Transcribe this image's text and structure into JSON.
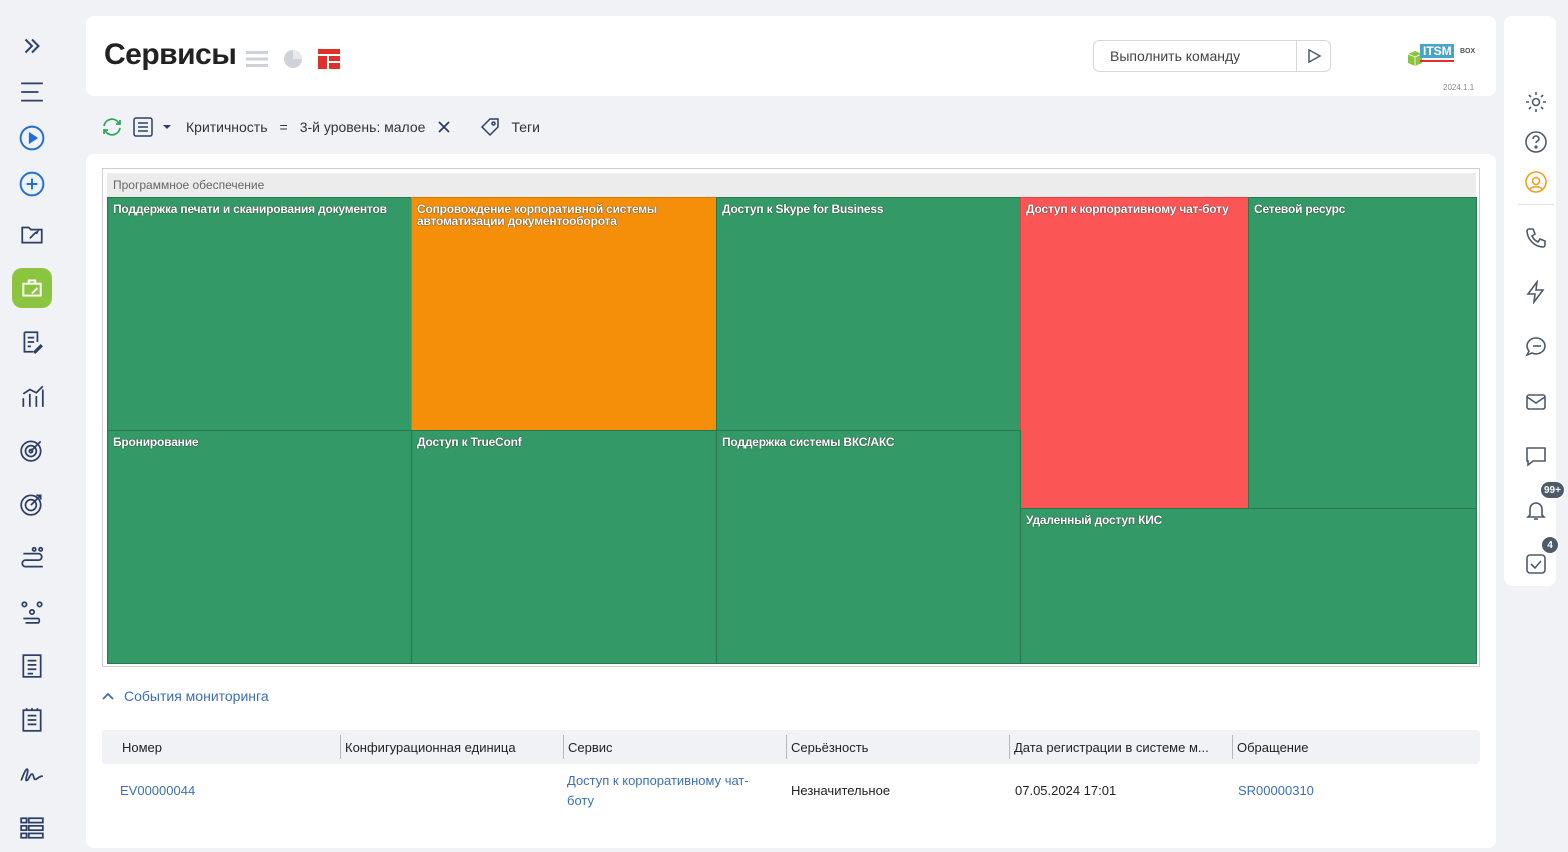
{
  "page": {
    "title": "Сервисы"
  },
  "command": {
    "placeholder": "Выполнить команду"
  },
  "logo": {
    "brand": "ITSM",
    "suffix": "BOX",
    "version": "2024.1.1"
  },
  "filter": {
    "field": "Критичность",
    "operator": "=",
    "value": "3-й уровень: малое",
    "tags_label": "Теги"
  },
  "treemap": {
    "group": "Программное обеспечение",
    "tiles": [
      {
        "label": "Поддержка печати и сканирования документов",
        "status": "green"
      },
      {
        "label": "Сопровождение корпоративной системы автоматизации документооборота",
        "status": "orange"
      },
      {
        "label": "Доступ к Skype for Business",
        "status": "green"
      },
      {
        "label": "Доступ к корпоративному чат-боту",
        "status": "red"
      },
      {
        "label": "Сетевой ресурс",
        "status": "green"
      },
      {
        "label": "Бронирование",
        "status": "green"
      },
      {
        "label": "Доступ к TrueConf",
        "status": "green"
      },
      {
        "label": "Поддержка системы ВКС/АКС",
        "status": "green"
      },
      {
        "label": "Удаленный доступ КИС",
        "status": "green"
      }
    ],
    "colors": {
      "green": "#339966",
      "orange": "#f58f0a",
      "red": "#fb5555"
    }
  },
  "events": {
    "section_title": "События мониторинга",
    "columns": [
      "Номер",
      "Конфигурационная единица",
      "Сервис",
      "Серьёзность",
      "Дата регистрации в системе м...",
      "Обращение"
    ],
    "rows": [
      {
        "number": "EV00000044",
        "ci": "",
        "service": "Доступ к корпоративному чат-боту",
        "severity": "Незначительное",
        "date": "07.05.2024 17:01",
        "request": "SR00000310"
      }
    ]
  },
  "notifications": {
    "bell_count": "99+",
    "tasks_count": "4"
  },
  "icons": {
    "left": [
      "expand-icon",
      "menu-icon",
      "play-icon",
      "add-icon",
      "folder-tools-icon",
      "briefcase-tools-icon",
      "document-edit-icon",
      "chart-icon",
      "target-icon",
      "target-check-icon",
      "route-icon",
      "workflow-icon",
      "list-document-icon",
      "checklist-icon",
      "signature-icon",
      "table-list-icon"
    ],
    "right": [
      "settings-icon",
      "help-icon",
      "support-agent-icon",
      "phone-icon",
      "lightning-icon",
      "chat-bubbles-icon",
      "mail-icon",
      "message-icon",
      "bell-icon",
      "task-check-icon"
    ]
  },
  "accent_colors": {
    "primary_blue": "#1e6fd9",
    "nav_active": "#8bc53f",
    "link": "#3a6fb9"
  }
}
